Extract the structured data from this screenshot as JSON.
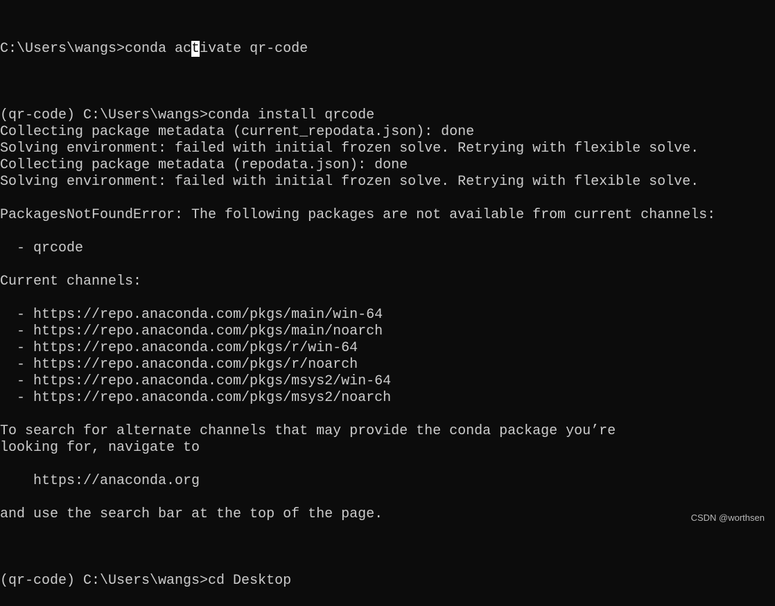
{
  "terminal": {
    "first_line": {
      "before_cursor": "C:\\Users\\wangs>conda ac",
      "cursor_char": "t",
      "after_cursor": "ivate qr-code"
    },
    "lines": [
      "",
      "(qr-code) C:\\Users\\wangs>conda install qrcode",
      "Collecting package metadata (current_repodata.json): done",
      "Solving environment: failed with initial frozen solve. Retrying with flexible solve.",
      "Collecting package metadata (repodata.json): done",
      "Solving environment: failed with initial frozen solve. Retrying with flexible solve.",
      "",
      "PackagesNotFoundError: The following packages are not available from current channels:",
      "",
      "  - qrcode",
      "",
      "Current channels:",
      "",
      "  - https://repo.anaconda.com/pkgs/main/win-64",
      "  - https://repo.anaconda.com/pkgs/main/noarch",
      "  - https://repo.anaconda.com/pkgs/r/win-64",
      "  - https://repo.anaconda.com/pkgs/r/noarch",
      "  - https://repo.anaconda.com/pkgs/msys2/win-64",
      "  - https://repo.anaconda.com/pkgs/msys2/noarch",
      "",
      "To search for alternate channels that may provide the conda package you’re",
      "looking for, navigate to",
      "",
      "    https://anaconda.org",
      "",
      "and use the search bar at the top of the page.",
      "",
      "",
      "",
      "(qr-code) C:\\Users\\wangs>cd Desktop"
    ]
  },
  "watermark": "CSDN @worthsen",
  "colors": {
    "background": "#0c0c0c",
    "text": "#cccccc",
    "cursor": "#ffffff"
  }
}
